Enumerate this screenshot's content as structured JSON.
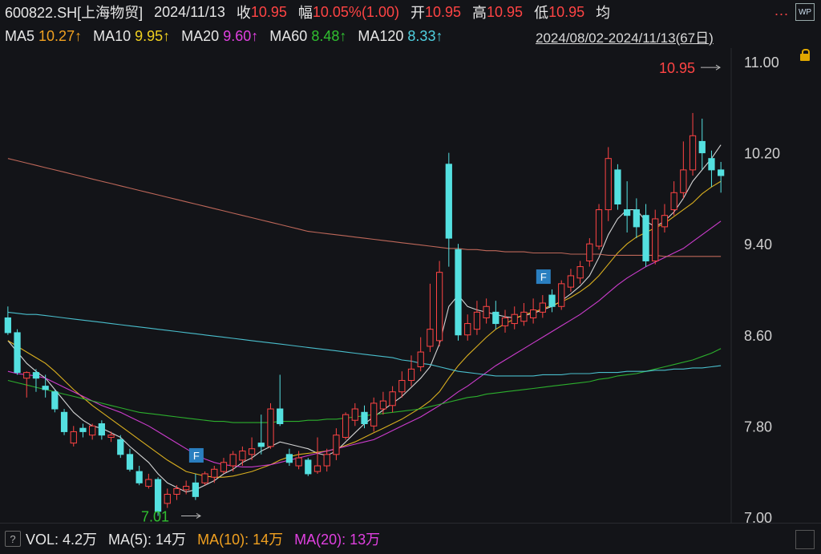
{
  "header": {
    "symbol": "600822.SH[上海物贸]",
    "date": "2024/11/13",
    "close_label": "收",
    "close_value": "10.95",
    "change_label": "幅",
    "change_value": "10.05%(1.00)",
    "open_label": "开",
    "open_value": "10.95",
    "high_label": "高",
    "high_value": "10.95",
    "low_label": "低",
    "low_value": "10.95",
    "avg_label": "均",
    "menu_dots": "...",
    "wp_label": "WP"
  },
  "ma": {
    "ma5_label": "MA5",
    "ma5_value": "10.27↑",
    "ma10_label": "MA10",
    "ma10_value": "9.95↑",
    "ma20_label": "MA20",
    "ma20_value": "9.60↑",
    "ma60_label": "MA60",
    "ma60_value": "8.48↑",
    "ma120_label": "MA120",
    "ma120_value": "8.33↑",
    "range": "2024/08/02-2024/11/13(67日)"
  },
  "volume": {
    "help": "?",
    "vol_label": "VOL: 4.2万",
    "ma5_label": "MA(5): 14万",
    "ma10_label": "MA(10): 14万",
    "ma20_label": "MA(20): 13万"
  },
  "colors": {
    "up": "#ff4444",
    "down": "#54e0e0",
    "ma5": "#e8e8e8",
    "ma10": "#f0c020",
    "ma20": "#e040e0",
    "ma60": "#30c030",
    "ma120": "#50d0e0",
    "ma250": "#d07060",
    "grid": "#2a2b30",
    "axis_text": "#cfcfcf"
  },
  "chart_data": {
    "type": "candlestick",
    "ylim": [
      6.95,
      11.12
    ],
    "yticks": [
      7.0,
      7.8,
      8.6,
      9.4,
      10.2,
      11.0
    ],
    "max_marker": "10.95",
    "min_marker": "7.01",
    "flags": [
      {
        "index": 20,
        "label": "F"
      },
      {
        "index": 57,
        "label": "F"
      }
    ],
    "candles": [
      [
        8.75,
        8.62,
        8.85,
        8.6
      ],
      [
        8.62,
        8.27,
        8.65,
        8.25
      ],
      [
        8.22,
        8.27,
        8.28,
        8.05
      ],
      [
        8.27,
        8.22,
        8.3,
        8.1
      ],
      [
        8.15,
        8.12,
        8.25,
        8.05
      ],
      [
        8.1,
        7.95,
        8.12,
        7.92
      ],
      [
        7.92,
        7.75,
        7.95,
        7.72
      ],
      [
        7.65,
        7.75,
        7.8,
        7.62
      ],
      [
        7.78,
        7.75,
        7.82,
        7.7
      ],
      [
        7.72,
        7.8,
        7.82,
        7.68
      ],
      [
        7.82,
        7.72,
        7.85,
        7.68
      ],
      [
        7.7,
        7.72,
        7.75,
        7.66
      ],
      [
        7.68,
        7.55,
        7.72,
        7.52
      ],
      [
        7.55,
        7.42,
        7.6,
        7.4
      ],
      [
        7.4,
        7.3,
        7.45,
        7.28
      ],
      [
        7.27,
        7.33,
        7.38,
        7.25
      ],
      [
        7.33,
        7.05,
        7.35,
        7.01
      ],
      [
        7.12,
        7.2,
        7.25,
        7.08
      ],
      [
        7.2,
        7.25,
        7.28,
        7.15
      ],
      [
        7.24,
        7.27,
        7.32,
        7.2
      ],
      [
        7.3,
        7.18,
        7.38,
        7.15
      ],
      [
        7.3,
        7.38,
        7.4,
        7.28
      ],
      [
        7.35,
        7.42,
        7.45,
        7.3
      ],
      [
        7.4,
        7.48,
        7.52,
        7.38
      ],
      [
        7.45,
        7.55,
        7.58,
        7.4
      ],
      [
        7.5,
        7.58,
        7.62,
        7.45
      ],
      [
        7.55,
        7.6,
        7.7,
        7.5
      ],
      [
        7.65,
        7.62,
        7.9,
        7.55
      ],
      [
        7.62,
        7.95,
        8.0,
        7.6
      ],
      [
        7.95,
        7.82,
        8.25,
        7.8
      ],
      [
        7.55,
        7.48,
        7.6,
        7.45
      ],
      [
        7.45,
        7.52,
        7.58,
        7.42
      ],
      [
        7.5,
        7.38,
        7.52,
        7.36
      ],
      [
        7.4,
        7.45,
        7.7,
        7.38
      ],
      [
        7.45,
        7.55,
        7.6,
        7.4
      ],
      [
        7.55,
        7.72,
        7.78,
        7.5
      ],
      [
        7.7,
        7.9,
        7.92,
        7.68
      ],
      [
        7.85,
        7.95,
        8.0,
        7.8
      ],
      [
        7.92,
        7.82,
        7.98,
        7.78
      ],
      [
        7.8,
        8.0,
        8.05,
        7.75
      ],
      [
        7.95,
        8.02,
        8.1,
        7.9
      ],
      [
        7.98,
        8.1,
        8.15,
        7.92
      ],
      [
        8.1,
        8.2,
        8.28,
        8.05
      ],
      [
        8.2,
        8.3,
        8.42,
        8.15
      ],
      [
        8.32,
        8.45,
        8.58,
        8.28
      ],
      [
        8.5,
        8.65,
        9.05,
        8.45
      ],
      [
        8.55,
        9.15,
        9.25,
        8.5
      ],
      [
        10.1,
        9.45,
        10.2,
        9.2
      ],
      [
        9.35,
        8.6,
        9.4,
        8.55
      ],
      [
        8.6,
        8.7,
        8.78,
        8.55
      ],
      [
        8.65,
        8.8,
        8.9,
        8.6
      ],
      [
        8.75,
        8.85,
        8.92,
        8.7
      ],
      [
        8.8,
        8.7,
        8.9,
        8.65
      ],
      [
        8.68,
        8.75,
        8.82,
        8.62
      ],
      [
        8.7,
        8.78,
        8.85,
        8.65
      ],
      [
        8.72,
        8.8,
        8.88,
        8.68
      ],
      [
        8.75,
        8.82,
        8.92,
        8.7
      ],
      [
        8.8,
        8.88,
        8.95,
        8.75
      ],
      [
        8.95,
        8.85,
        9.0,
        8.8
      ],
      [
        8.85,
        9.05,
        9.08,
        8.82
      ],
      [
        9.02,
        9.12,
        9.18,
        8.98
      ],
      [
        9.1,
        9.2,
        9.25,
        9.05
      ],
      [
        9.25,
        9.4,
        9.45,
        9.2
      ],
      [
        9.38,
        9.7,
        9.75,
        9.35
      ],
      [
        9.7,
        10.15,
        10.25,
        9.6
      ],
      [
        10.05,
        9.75,
        10.1,
        9.7
      ],
      [
        9.7,
        9.65,
        9.95,
        9.5
      ],
      [
        9.7,
        9.55,
        9.8,
        9.45
      ],
      [
        9.65,
        9.25,
        9.75,
        9.2
      ],
      [
        9.25,
        9.62,
        9.7,
        9.22
      ],
      [
        9.55,
        9.65,
        9.75,
        9.5
      ],
      [
        9.7,
        9.85,
        9.95,
        9.65
      ],
      [
        9.85,
        10.05,
        10.3,
        9.8
      ],
      [
        10.05,
        10.35,
        10.55,
        10.0
      ],
      [
        10.3,
        10.2,
        10.5,
        10.05
      ],
      [
        10.15,
        10.05,
        10.22,
        9.9
      ],
      [
        10.05,
        10.0,
        10.12,
        9.85
      ]
    ],
    "ma_lines": {
      "MA5": [
        8.55,
        8.45,
        8.35,
        8.28,
        8.22,
        8.12,
        8.02,
        7.92,
        7.85,
        7.8,
        7.78,
        7.74,
        7.7,
        7.62,
        7.55,
        7.48,
        7.38,
        7.3,
        7.26,
        7.22,
        7.24,
        7.28,
        7.32,
        7.38,
        7.42,
        7.48,
        7.52,
        7.58,
        7.62,
        7.66,
        7.64,
        7.62,
        7.6,
        7.56,
        7.54,
        7.58,
        7.66,
        7.74,
        7.82,
        7.88,
        7.94,
        8.0,
        8.06,
        8.14,
        8.22,
        8.32,
        8.52,
        8.85,
        8.95,
        8.85,
        8.82,
        8.8,
        8.78,
        8.76,
        8.75,
        8.77,
        8.79,
        8.82,
        8.85,
        8.9,
        8.96,
        9.03,
        9.12,
        9.28,
        9.48,
        9.62,
        9.7,
        9.7,
        9.6,
        9.55,
        9.6,
        9.68,
        9.8,
        9.95,
        10.05,
        10.15,
        10.27
      ],
      "MA10": [
        8.55,
        8.5,
        8.45,
        8.4,
        8.35,
        8.28,
        8.2,
        8.12,
        8.05,
        7.98,
        7.92,
        7.86,
        7.8,
        7.74,
        7.68,
        7.62,
        7.56,
        7.5,
        7.45,
        7.4,
        7.38,
        7.36,
        7.35,
        7.35,
        7.36,
        7.38,
        7.4,
        7.43,
        7.46,
        7.5,
        7.53,
        7.55,
        7.56,
        7.57,
        7.58,
        7.6,
        7.63,
        7.66,
        7.7,
        7.74,
        7.78,
        7.82,
        7.86,
        7.91,
        7.96,
        8.02,
        8.1,
        8.22,
        8.33,
        8.42,
        8.5,
        8.58,
        8.65,
        8.7,
        8.74,
        8.78,
        8.8,
        8.83,
        8.86,
        8.89,
        8.93,
        8.98,
        9.04,
        9.12,
        9.22,
        9.32,
        9.4,
        9.46,
        9.5,
        9.54,
        9.58,
        9.64,
        9.7,
        9.76,
        9.84,
        9.9,
        9.95
      ],
      "MA20": [
        8.28,
        8.26,
        8.25,
        8.24,
        8.22,
        8.18,
        8.14,
        8.1,
        8.06,
        8.02,
        7.98,
        7.95,
        7.92,
        7.88,
        7.84,
        7.8,
        7.75,
        7.7,
        7.65,
        7.6,
        7.55,
        7.51,
        7.48,
        7.46,
        7.45,
        7.44,
        7.44,
        7.45,
        7.46,
        7.48,
        7.5,
        7.52,
        7.54,
        7.56,
        7.58,
        7.6,
        7.62,
        7.64,
        7.66,
        7.68,
        7.72,
        7.76,
        7.8,
        7.84,
        7.88,
        7.93,
        7.98,
        8.04,
        8.1,
        8.15,
        8.21,
        8.27,
        8.33,
        8.38,
        8.43,
        8.48,
        8.53,
        8.58,
        8.63,
        8.68,
        8.73,
        8.78,
        8.84,
        8.9,
        8.97,
        9.04,
        9.1,
        9.15,
        9.2,
        9.24,
        9.28,
        9.32,
        9.36,
        9.42,
        9.48,
        9.54,
        9.6
      ],
      "MA60": [
        8.2,
        8.18,
        8.16,
        8.14,
        8.12,
        8.1,
        8.08,
        8.06,
        8.04,
        8.02,
        8.0,
        7.98,
        7.96,
        7.94,
        7.92,
        7.91,
        7.9,
        7.89,
        7.88,
        7.87,
        7.86,
        7.85,
        7.84,
        7.84,
        7.83,
        7.83,
        7.83,
        7.83,
        7.83,
        7.84,
        7.84,
        7.84,
        7.85,
        7.85,
        7.86,
        7.86,
        7.87,
        7.88,
        7.89,
        7.9,
        7.91,
        7.92,
        7.93,
        7.94,
        7.95,
        7.97,
        7.99,
        8.01,
        8.03,
        8.05,
        8.06,
        8.08,
        8.09,
        8.1,
        8.11,
        8.12,
        8.13,
        8.14,
        8.15,
        8.16,
        8.17,
        8.18,
        8.19,
        8.21,
        8.22,
        8.24,
        8.25,
        8.26,
        8.28,
        8.3,
        8.32,
        8.34,
        8.36,
        8.38,
        8.41,
        8.44,
        8.48
      ],
      "MA120": [
        8.8,
        8.79,
        8.78,
        8.78,
        8.77,
        8.76,
        8.75,
        8.74,
        8.73,
        8.72,
        8.71,
        8.7,
        8.69,
        8.68,
        8.67,
        8.66,
        8.65,
        8.64,
        8.63,
        8.62,
        8.61,
        8.6,
        8.59,
        8.58,
        8.57,
        8.56,
        8.55,
        8.54,
        8.53,
        8.52,
        8.51,
        8.5,
        8.49,
        8.48,
        8.47,
        8.46,
        8.45,
        8.44,
        8.43,
        8.42,
        8.41,
        8.4,
        8.38,
        8.37,
        8.35,
        8.34,
        8.32,
        8.3,
        8.28,
        8.27,
        8.26,
        8.25,
        8.24,
        8.24,
        8.24,
        8.24,
        8.24,
        8.25,
        8.25,
        8.25,
        8.26,
        8.26,
        8.26,
        8.27,
        8.27,
        8.27,
        8.28,
        8.28,
        8.28,
        8.29,
        8.29,
        8.3,
        8.3,
        8.31,
        8.31,
        8.32,
        8.33
      ],
      "MA250": [
        10.15,
        10.13,
        10.11,
        10.09,
        10.07,
        10.05,
        10.03,
        10.01,
        9.99,
        9.97,
        9.95,
        9.93,
        9.91,
        9.89,
        9.87,
        9.85,
        9.83,
        9.81,
        9.79,
        9.77,
        9.75,
        9.73,
        9.71,
        9.69,
        9.67,
        9.65,
        9.63,
        9.61,
        9.59,
        9.57,
        9.55,
        9.53,
        9.51,
        9.5,
        9.49,
        9.48,
        9.47,
        9.46,
        9.45,
        9.44,
        9.43,
        9.42,
        9.41,
        9.4,
        9.39,
        9.38,
        9.37,
        9.36,
        9.36,
        9.35,
        9.35,
        9.34,
        9.34,
        9.33,
        9.33,
        9.33,
        9.32,
        9.32,
        9.32,
        9.32,
        9.31,
        9.31,
        9.31,
        9.31,
        9.3,
        9.3,
        9.3,
        9.3,
        9.3,
        9.3,
        9.29,
        9.29,
        9.29,
        9.29,
        9.29,
        9.29,
        9.29
      ]
    }
  }
}
